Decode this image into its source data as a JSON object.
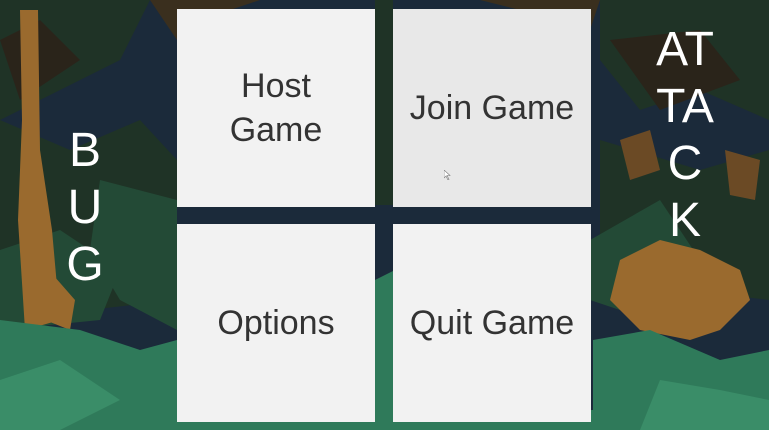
{
  "title": {
    "left_word": "BUG",
    "right_word": "ATTACK"
  },
  "menu": {
    "host_game": "Host Game",
    "join_game": "Join Game",
    "options": "Options",
    "quit_game": "Quit Game"
  },
  "colors": {
    "sky_dark": "#1b2a3a",
    "foliage_dark": "#1f3326",
    "foliage_mid": "#234a36",
    "foliage_light": "#2f7a5a",
    "trunk_brown": "#9a6a2e",
    "button_bg": "#f2f2f2",
    "button_text": "#333333",
    "title_text": "#ffffff"
  },
  "icons": {
    "cursor": "mouse-pointer-icon"
  }
}
